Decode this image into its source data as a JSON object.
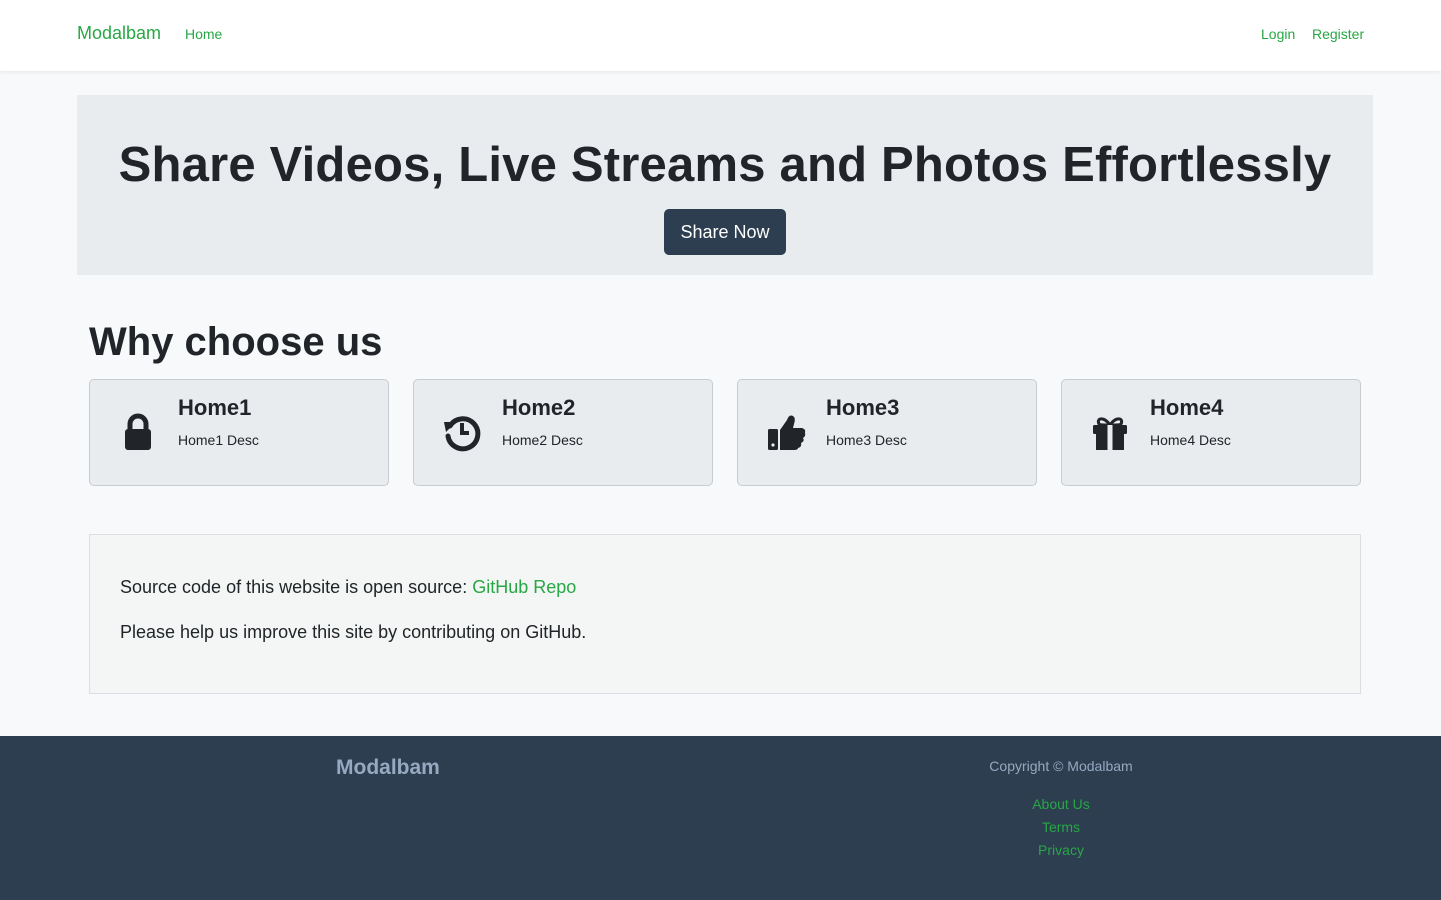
{
  "navbar": {
    "brand": "Modalbam",
    "links": {
      "home": "Home",
      "login": "Login",
      "register": "Register"
    }
  },
  "hero": {
    "title": "Share Videos, Live Streams and Photos Effortlessly",
    "button_label": "Share Now"
  },
  "features": {
    "title": "Why choose us",
    "cards": [
      {
        "title": "Home1",
        "desc": "Home1 Desc",
        "icon": "lock-icon"
      },
      {
        "title": "Home2",
        "desc": "Home2 Desc",
        "icon": "history-icon"
      },
      {
        "title": "Home3",
        "desc": "Home3 Desc",
        "icon": "thumbs-up-icon"
      },
      {
        "title": "Home4",
        "desc": "Home4 Desc",
        "icon": "gift-icon"
      }
    ]
  },
  "open_source": {
    "line1_prefix": "Source code of this website is open source: ",
    "line1_link": "GitHub Repo",
    "line2": "Please help us improve this site by contributing on GitHub."
  },
  "footer": {
    "brand": "Modalbam",
    "copyright": "Copyright © Modalbam",
    "links": [
      "About Us",
      "Terms",
      "Privacy"
    ]
  },
  "colors": {
    "accent": "#28a745",
    "dark": "#2c3e50",
    "hero_bg": "#e9ecef",
    "page_bg": "#f8f9fa"
  }
}
